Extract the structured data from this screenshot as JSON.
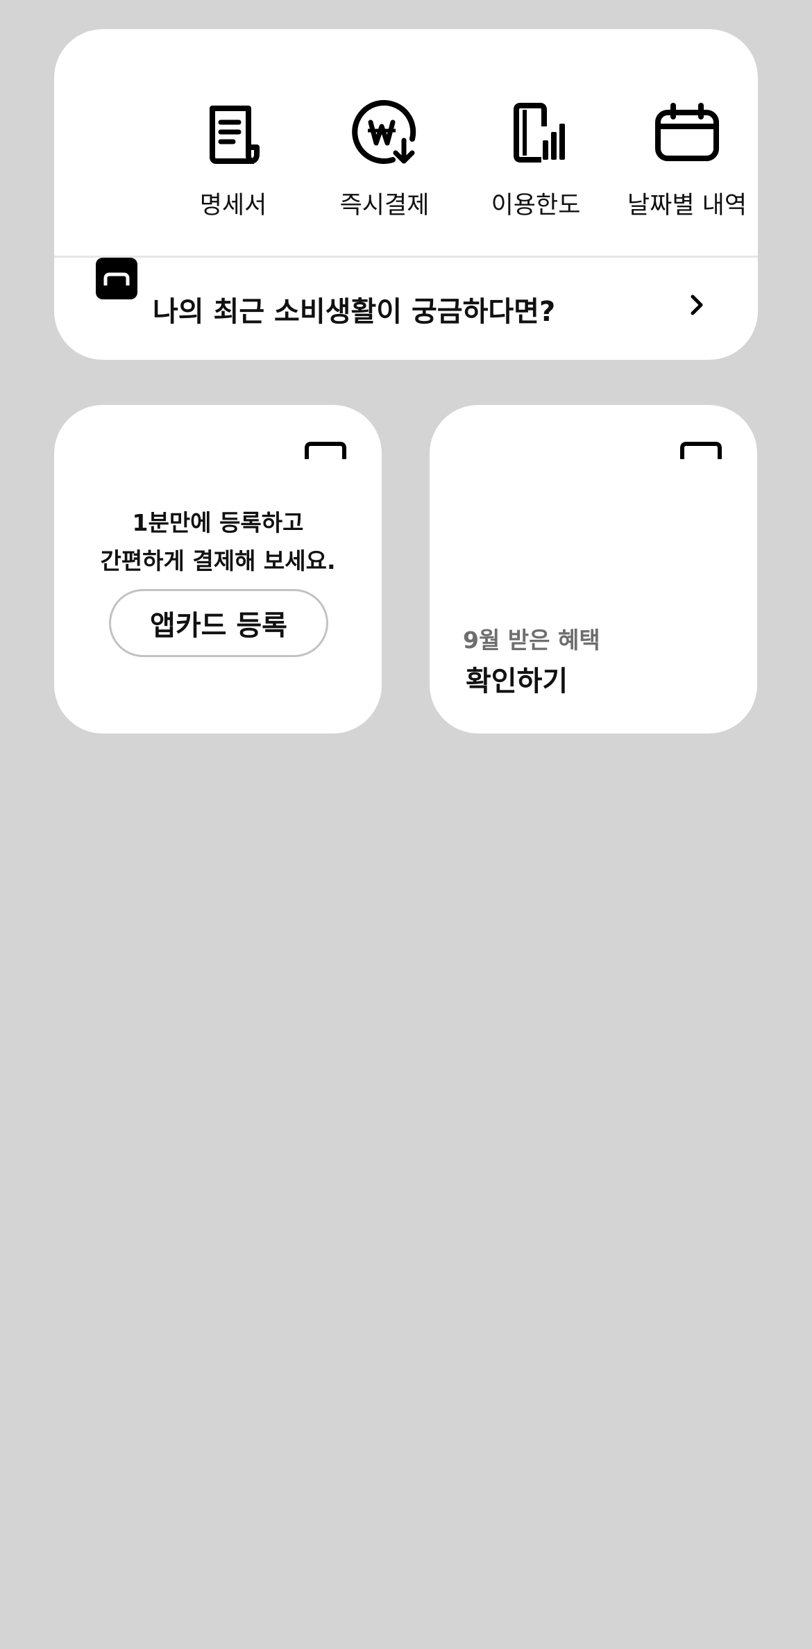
{
  "quick_menu": {
    "items": [
      {
        "label": "명세서",
        "icon": "statement-receipt-icon"
      },
      {
        "label": "즉시결제",
        "icon": "won-instant-pay-icon"
      },
      {
        "label": "이용한도",
        "icon": "card-limit-chart-icon"
      },
      {
        "label": "날짜별 내역",
        "icon": "calendar-icon"
      }
    ]
  },
  "banner": {
    "text": "나의 최근 소비생활이 궁금하다면?",
    "icon": "card-brand-icon",
    "chevron_icon": "chevron-right-icon"
  },
  "register_card": {
    "line1": "1분만에 등록하고",
    "line2": "간편하게 결제해 보세요.",
    "button_label": "앱카드 등록",
    "corner_icon": "card-brand-icon"
  },
  "benefit_card": {
    "subtitle": "9월 받은 혜택",
    "title": "확인하기",
    "corner_icon": "card-brand-icon"
  },
  "colors": {
    "background": "#d4d4d4",
    "card": "#ffffff",
    "text_primary": "#111111",
    "text_secondary": "#6e6e6e",
    "divider": "#e6e6e6",
    "button_border": "#c2c2c2"
  }
}
